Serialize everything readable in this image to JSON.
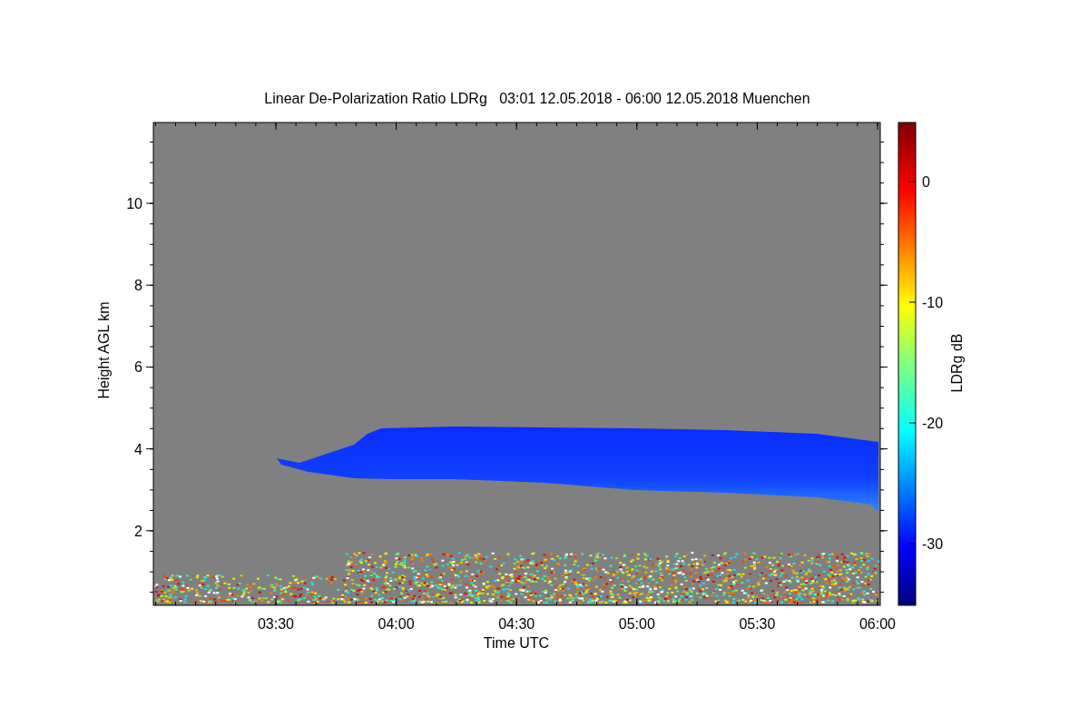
{
  "title": "Linear De-Polarization Ratio LDRg   03:01 12.05.2018 - 06:00 12.05.2018 Muenchen",
  "x_axis": {
    "label": "Time UTC",
    "ticks": [
      "03:30",
      "04:00",
      "04:30",
      "05:00",
      "05:30",
      "06:00"
    ]
  },
  "y_axis": {
    "label": "Height AGL km",
    "ticks": [
      "10",
      "8",
      "6",
      "4",
      "2"
    ]
  },
  "colorbar": {
    "label": "LDRg dB",
    "ticks": [
      "0",
      "-10",
      "-20",
      "-30"
    ]
  }
}
